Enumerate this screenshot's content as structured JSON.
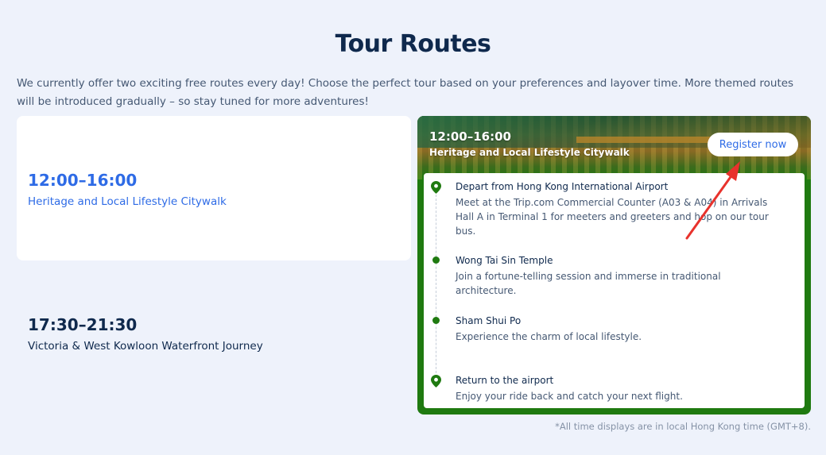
{
  "page": {
    "title": "Tour Routes",
    "intro": "We currently offer two exciting free routes every day! Choose the perfect tour based on your preferences and layover time. More themed routes will be introduced gradually – so stay tuned for more adventures!"
  },
  "routes": [
    {
      "time": "12:00–16:00",
      "name": "Heritage and Local Lifestyle Citywalk",
      "selected": true
    },
    {
      "time": "17:30–21:30",
      "name": "Victoria & West Kowloon Waterfront Journey",
      "selected": false
    }
  ],
  "detail": {
    "time": "12:00–16:00",
    "name": "Heritage and Local Lifestyle Citywalk",
    "register_label": "Register now",
    "stops": [
      {
        "icon": "location-pin-icon",
        "title": "Depart from Hong Kong International Airport",
        "desc": "Meet at the Trip.com Commercial Counter (A03 & A04) in Arrivals Hall A in Terminal 1 for meeters and greeters and hop on our tour bus."
      },
      {
        "icon": "dot-icon",
        "title": "Wong Tai Sin Temple",
        "desc": "Join a fortune-telling session and immerse in traditional architecture."
      },
      {
        "icon": "dot-icon",
        "title": "Sham Shui Po",
        "desc": "Experience the charm of local lifestyle."
      },
      {
        "icon": "location-pin-icon",
        "title": "Return to the airport",
        "desc": "Enjoy your ride back and catch your next flight."
      }
    ]
  },
  "footnote": "*All time displays are in local Hong Kong time (GMT+8).",
  "colors": {
    "accent": "#2e6be6",
    "route_green": "#1f7a10",
    "heading": "#0f294d",
    "annotation_arrow": "#e8322c"
  }
}
